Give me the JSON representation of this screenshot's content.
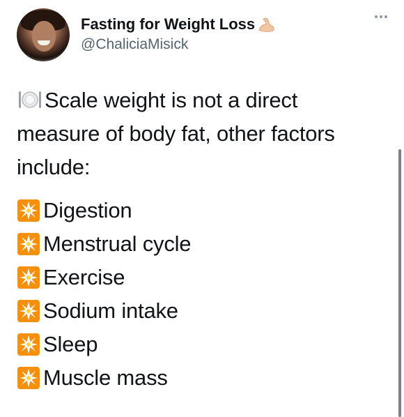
{
  "tweet": {
    "display_name": "Fasting for Weight Loss",
    "handle": "@ChaliciaMisick",
    "icons": {
      "name_emoji": "flexed-biceps-icon",
      "intro_emoji": "fork-knife-plate-icon",
      "bullet_emoji": "eight-pointed-star-icon",
      "more": "more-options-icon"
    },
    "intro_text": "Scale weight is not a direct measure of body fat, other factors include:",
    "factors": [
      "Digestion",
      "Menstrual cycle",
      "Exercise",
      "Sodium intake",
      "Sleep",
      "Muscle mass"
    ]
  },
  "colors": {
    "text": "#0f1419",
    "secondary": "#536471",
    "burst_orange": "#f4900c",
    "burst_star": "#ffd23f"
  }
}
